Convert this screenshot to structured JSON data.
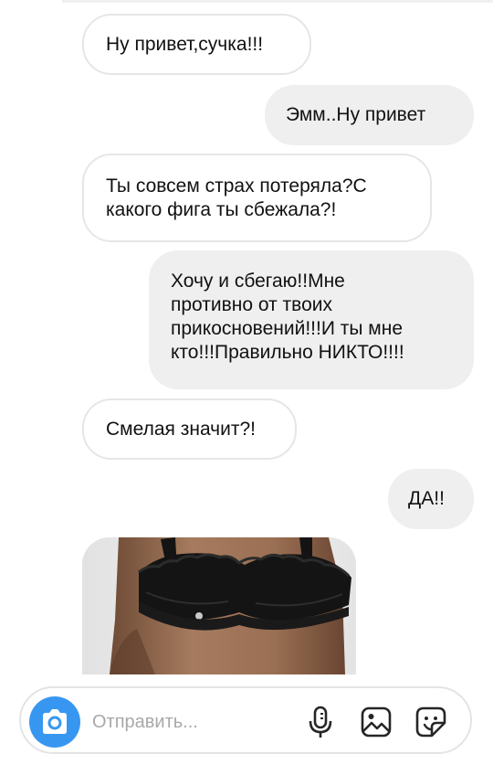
{
  "messages": [
    {
      "side": "incoming",
      "text": "Ну привет,сучка!!!"
    },
    {
      "side": "outgoing",
      "text": "Эмм..Ну привет"
    },
    {
      "side": "incoming",
      "text": "Ты совсем страх потеряла?С\nкакого фига ты сбежала?!"
    },
    {
      "side": "outgoing",
      "text": "Хочу и сбегаю!!Мне\nпротивно от твоих\nприкосновений!!!И ты мне\nкто!!!Правильно НИКТО!!!!"
    },
    {
      "side": "incoming",
      "text": "Смелая значит?!"
    },
    {
      "side": "outgoing",
      "text": "ДА!!"
    }
  ],
  "photo_message": {
    "kind": "image",
    "icon": "photo-lingerie"
  },
  "composer": {
    "placeholder": "Отправить...",
    "value": "",
    "icons": [
      "camera-icon",
      "microphone-icon",
      "gallery-icon",
      "sticker-icon"
    ]
  },
  "colors": {
    "accent": "#3797f0",
    "outgoing_bubble": "#efefef",
    "incoming_border": "#e6e6e6",
    "text": "#111111",
    "placeholder": "#a8a8a8"
  }
}
